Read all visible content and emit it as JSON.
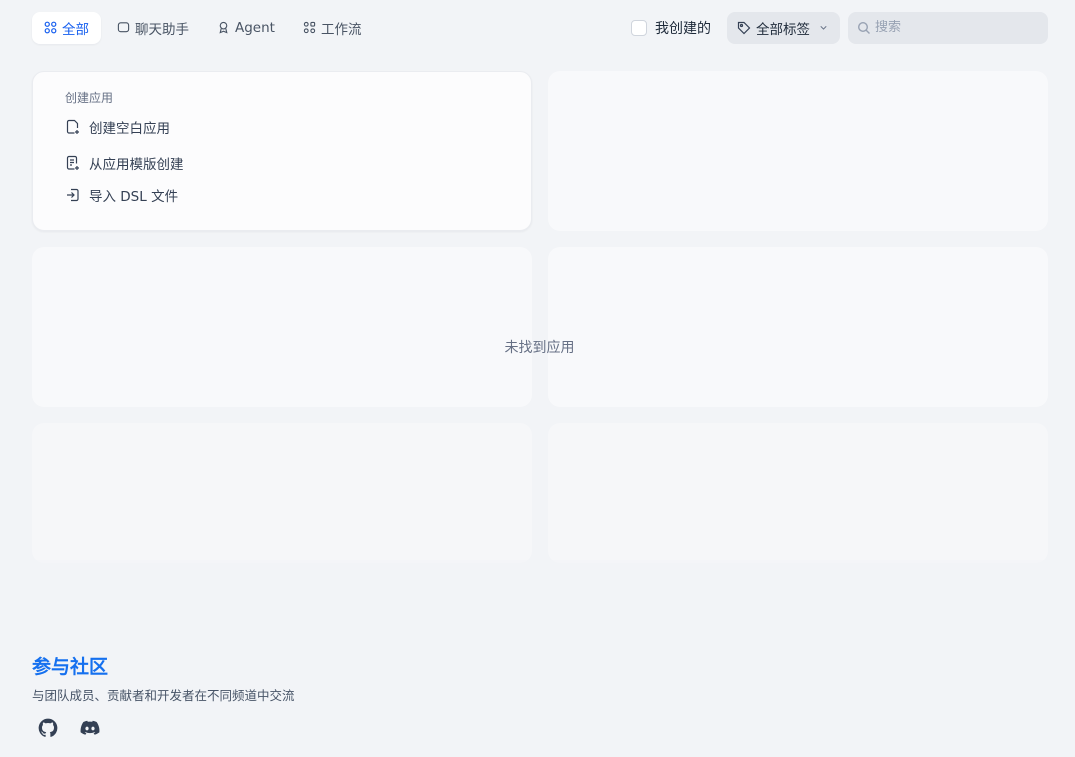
{
  "tabs": [
    {
      "label": "全部",
      "icon": "grid-icon",
      "active": true
    },
    {
      "label": "聊天助手",
      "icon": "chat-bubble-icon",
      "active": false
    },
    {
      "label": "Agent",
      "icon": "agent-icon",
      "active": false
    },
    {
      "label": "工作流",
      "icon": "workflow-icon",
      "active": false
    }
  ],
  "filters": {
    "mine_label": "我创建的",
    "mine_checked": false,
    "tags_label": "全部标签",
    "search_placeholder": "搜索"
  },
  "create_card": {
    "title": "创建应用",
    "items": [
      {
        "label": "创建空白应用",
        "icon": "blank-file-add-icon"
      },
      {
        "label": "从应用模版创建",
        "icon": "template-file-icon"
      },
      {
        "label": "导入 DSL 文件",
        "icon": "import-icon"
      }
    ]
  },
  "empty_state": "未找到应用",
  "community": {
    "title": "参与社区",
    "subtitle": "与团队成员、贡献者和开发者在不同频道中交流",
    "links": [
      "github-icon",
      "discord-icon"
    ]
  },
  "colors": {
    "accent": "#155eef",
    "community_title": "#1570ef",
    "background": "#f2f4f7"
  }
}
